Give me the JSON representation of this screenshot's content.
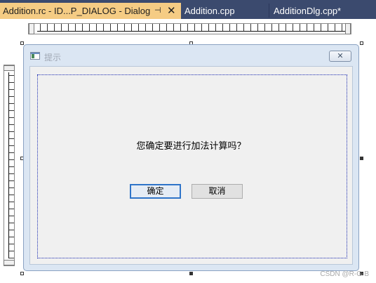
{
  "tabs": [
    {
      "label": "Addition.rc - ID...P_DIALOG - Dialog",
      "active": true
    },
    {
      "label": "Addition.cpp",
      "active": false
    },
    {
      "label": "AdditionDlg.cpp*",
      "active": false
    }
  ],
  "tab_icons": {
    "pin": "pin-icon",
    "close": "close-icon"
  },
  "dialog": {
    "title": "提示",
    "close_glyph": "✕",
    "prompt": "您确定要进行加法计算吗？",
    "ok_label": "确定",
    "cancel_label": "取消"
  },
  "watermark": "CSDN @R-G-B",
  "colors": {
    "tab_strip": "#3b4a6e",
    "active_tab": "#f5cc84",
    "dialog_frame": "#dbe6f3",
    "client": "#f0f0f0",
    "focus_border": "#2f74c9"
  }
}
